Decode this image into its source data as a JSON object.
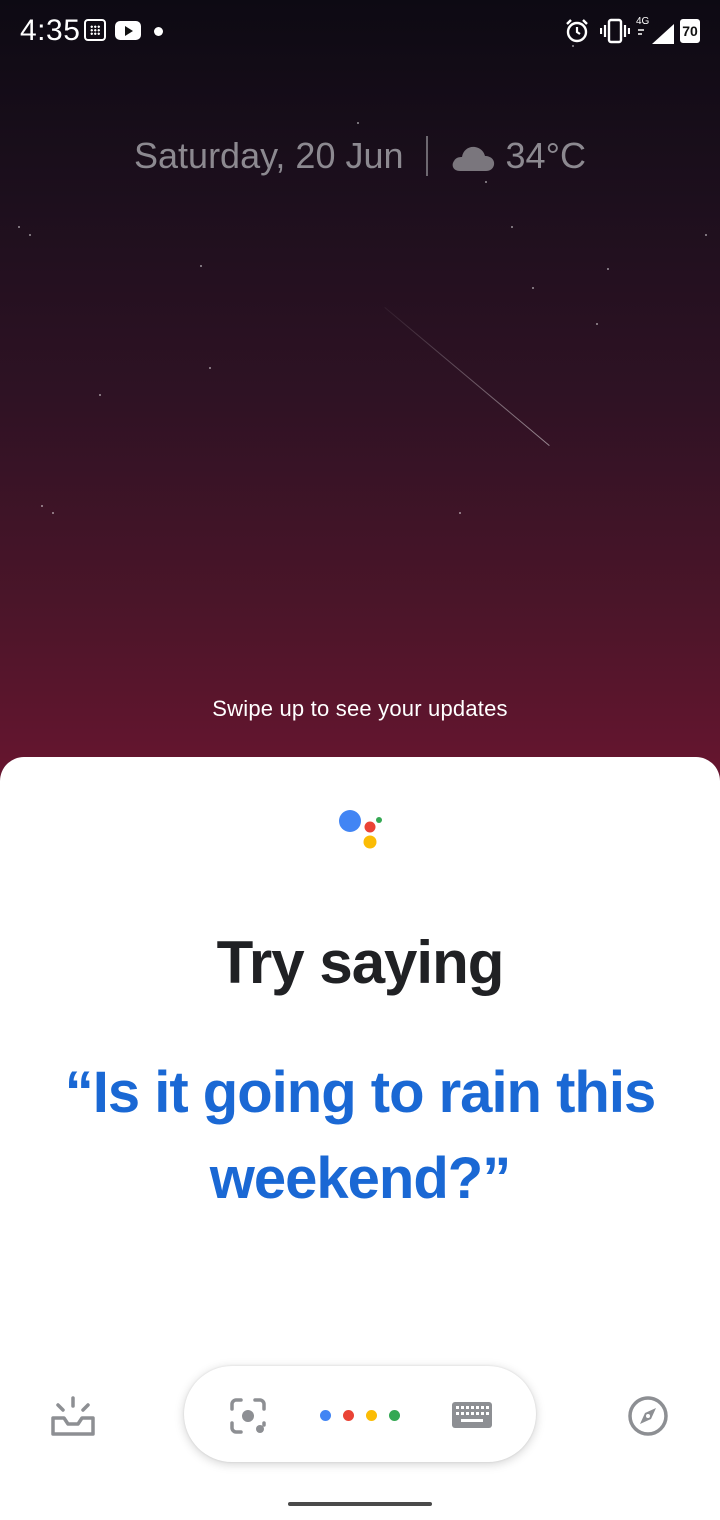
{
  "status_bar": {
    "time": "4:35",
    "network": "4G",
    "battery": "70",
    "icons": [
      "notification-grid-icon",
      "youtube-icon",
      "notification-dot-icon",
      "alarm-icon",
      "vibrate-icon",
      "signal-icon",
      "battery-icon"
    ]
  },
  "wallpaper_widget": {
    "date": "Saturday, 20 Jun",
    "weather_icon": "cloud-icon",
    "temperature": "34°C"
  },
  "swipe_hint": "Swipe up to see your updates",
  "assistant": {
    "logo_icon": "google-assistant-icon",
    "heading": "Try saying",
    "suggestion": "“Is it going to rain this weekend?”",
    "colors": {
      "blue": "#4285F4",
      "red": "#EA4335",
      "yellow": "#FBBC05",
      "green": "#34A853",
      "suggestion_text": "#1A68D4"
    }
  },
  "bottom_bar": {
    "left_icon": "updates-tray-icon",
    "lens_icon": "lens-icon",
    "mic_dots_icon": "assistant-dots-icon",
    "keyboard_icon": "keyboard-icon",
    "right_icon": "explore-compass-icon"
  }
}
